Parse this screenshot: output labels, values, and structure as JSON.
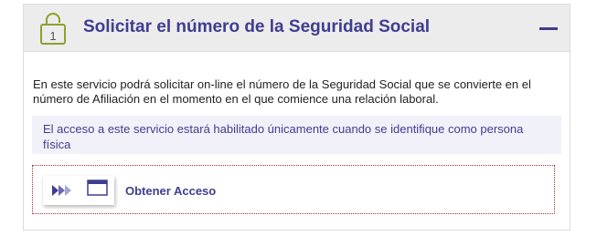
{
  "section": {
    "title": "Solicitar el número de la Seguridad Social",
    "lock_number": "1"
  },
  "content": {
    "description": "En este servicio podrá solicitar on-line el número de la Seguridad Social que se convierte en el número de Afiliación en el momento en el que comience una relación laboral.",
    "notice": "El acceso a este servicio estará habilitado únicamente cuando se identifique como persona física"
  },
  "access": {
    "label": "Obtener Acceso"
  },
  "colors": {
    "accent": "#3f3d8f",
    "lock_green": "#8da12b",
    "header_bg": "#ececec",
    "notice_bg": "#f1f1fa",
    "dotted_border": "#a33232"
  },
  "icons": {
    "lock": "padlock-icon",
    "collapse": "minus-icon",
    "access_arrows": "triple-arrow-icon",
    "access_window": "browser-window-icon"
  }
}
